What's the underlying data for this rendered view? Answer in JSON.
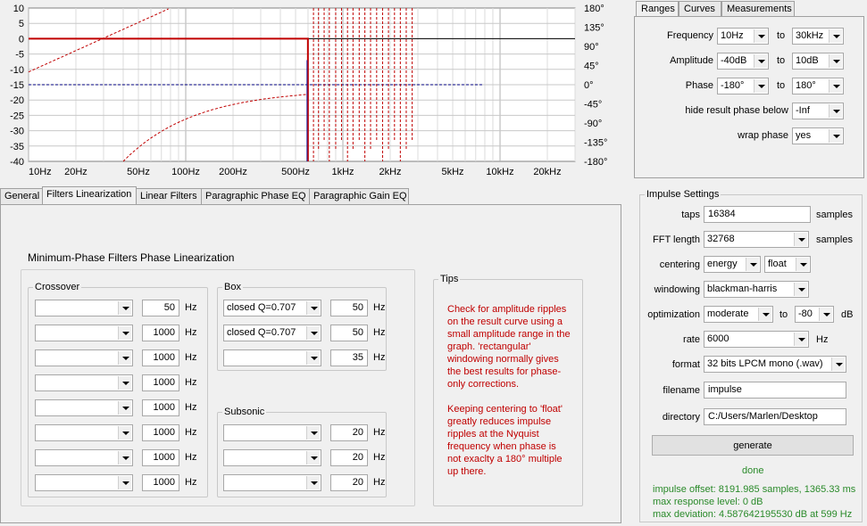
{
  "graph": {
    "y_left_ticks": [
      "10",
      "5",
      "0",
      "-5",
      "-10",
      "-15",
      "-20",
      "-25",
      "-30",
      "-35",
      "-40"
    ],
    "y_right_ticks": [
      "180°",
      "135°",
      "90°",
      "45°",
      "0°",
      "-45°",
      "-90°",
      "-135°",
      "-180°"
    ],
    "x_ticks": [
      "10Hz",
      "20Hz",
      "50Hz",
      "100Hz",
      "200Hz",
      "500Hz",
      "1kHz",
      "2kHz",
      "5kHz",
      "10kHz",
      "20kHz"
    ],
    "colors": {
      "amplitude": "#c00000",
      "phase": "#c00000",
      "dashed_zero": "#000080"
    }
  },
  "tabs": [
    {
      "label": "General"
    },
    {
      "label": "Filters Linearization"
    },
    {
      "label": "Linear Filters"
    },
    {
      "label": "Paragraphic Phase EQ"
    },
    {
      "label": "Paragraphic Gain EQ"
    }
  ],
  "panel": {
    "title": "Minimum-Phase Filters Phase Linearization",
    "crossover": {
      "label": "Crossover",
      "rows": [
        {
          "type": "",
          "value": "50",
          "unit": "Hz"
        },
        {
          "type": "",
          "value": "1000",
          "unit": "Hz"
        },
        {
          "type": "",
          "value": "1000",
          "unit": "Hz"
        },
        {
          "type": "",
          "value": "1000",
          "unit": "Hz"
        },
        {
          "type": "",
          "value": "1000",
          "unit": "Hz"
        },
        {
          "type": "",
          "value": "1000",
          "unit": "Hz"
        },
        {
          "type": "",
          "value": "1000",
          "unit": "Hz"
        },
        {
          "type": "",
          "value": "1000",
          "unit": "Hz"
        }
      ]
    },
    "box": {
      "label": "Box",
      "rows": [
        {
          "type": "closed Q=0.707",
          "value": "50",
          "unit": "Hz"
        },
        {
          "type": "closed Q=0.707",
          "value": "50",
          "unit": "Hz"
        },
        {
          "type": "",
          "value": "35",
          "unit": "Hz"
        }
      ]
    },
    "subsonic": {
      "label": "Subsonic",
      "rows": [
        {
          "type": "",
          "value": "20",
          "unit": "Hz"
        },
        {
          "type": "",
          "value": "20",
          "unit": "Hz"
        },
        {
          "type": "",
          "value": "20",
          "unit": "Hz"
        }
      ]
    },
    "tips": {
      "label": "Tips",
      "para1": "Check for amplitude ripples on the result curve using a small amplitude range in the graph. 'rectangular' windowing normally gives the best results for phase-only corrections.",
      "para2": "Keeping centering to 'float' greatly reduces impulse ripples at the Nyquist frequency when phase is not exaclty a 180° multiple up there."
    }
  },
  "right_tabs": [
    {
      "label": "Ranges"
    },
    {
      "label": "Curves"
    },
    {
      "label": "Measurements"
    }
  ],
  "ranges": {
    "frequency": {
      "label": "Frequency",
      "from": "10Hz",
      "to_label": "to",
      "to": "30kHz"
    },
    "amplitude": {
      "label": "Amplitude",
      "from": "-40dB",
      "to_label": "to",
      "to": "10dB"
    },
    "phase": {
      "label": "Phase",
      "from": "-180°",
      "to_label": "to",
      "to": "180°"
    },
    "hide_phase": {
      "label": "hide result phase below",
      "value": "-Inf"
    },
    "wrap_phase": {
      "label": "wrap phase",
      "value": "yes"
    }
  },
  "impulse": {
    "label": "Impulse Settings",
    "taps": {
      "label": "taps",
      "value": "16384",
      "unit": "samples"
    },
    "fft": {
      "label": "FFT length",
      "value": "32768",
      "unit": "samples"
    },
    "centering": {
      "label": "centering",
      "value1": "energy",
      "value2": "float"
    },
    "windowing": {
      "label": "windowing",
      "value": "blackman-harris"
    },
    "optimization": {
      "label": "optimization",
      "value": "moderate",
      "to_label": "to",
      "value2": "-80",
      "unit": "dB"
    },
    "rate": {
      "label": "rate",
      "value": "6000",
      "unit": "Hz"
    },
    "format": {
      "label": "format",
      "value": "32 bits LPCM mono (.wav)"
    },
    "filename": {
      "label": "filename",
      "value": "impulse"
    },
    "directory": {
      "label": "directory",
      "value": "C:/Users/Marlen/Desktop"
    },
    "generate_label": "generate",
    "status": "done",
    "info1": "impulse offset: 8191.985 samples, 1365.33 ms",
    "info2": "max response level: 0 dB",
    "info3": "max deviation: 4.587642195530 dB at 599 Hz"
  }
}
